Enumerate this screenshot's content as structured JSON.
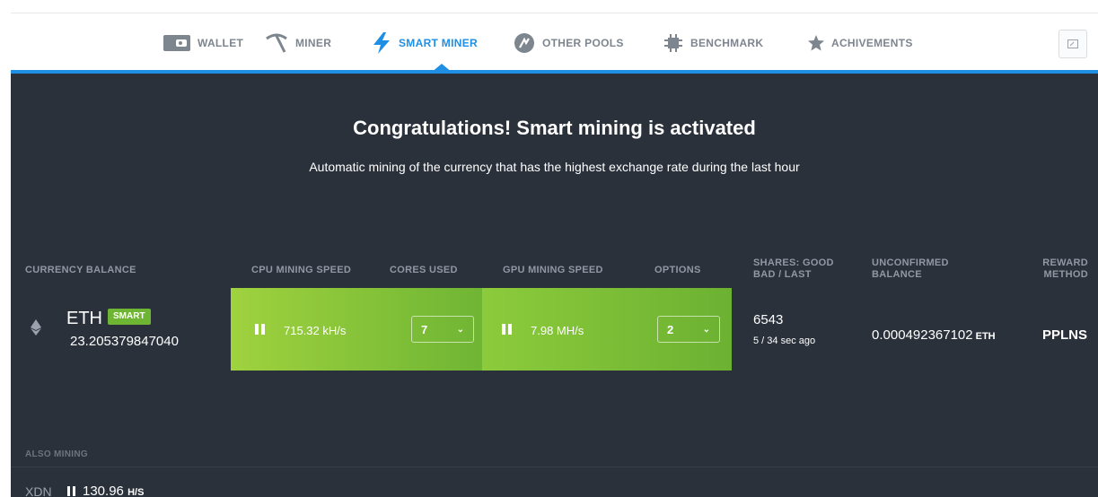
{
  "nav": {
    "tabs": [
      {
        "label": "WALLET",
        "icon": "wallet-icon"
      },
      {
        "label": "MINER",
        "icon": "pickaxe-icon"
      },
      {
        "label": "SMART MINER",
        "icon": "lightning-icon",
        "active": true
      },
      {
        "label": "OTHER POOLS",
        "icon": "pools-icon"
      },
      {
        "label": "BENCHMARK",
        "icon": "chip-icon"
      },
      {
        "label": "ACHIVEMENTS",
        "icon": "star-icon"
      }
    ],
    "corner_icon": "window-icon"
  },
  "headline": "Congratulations! Smart mining is activated",
  "subhead": "Automatic mining of the currency that has the highest exchange rate during the last hour",
  "table": {
    "headers": {
      "currency_balance": "CURRENCY BALANCE",
      "cpu_speed": "CPU MINING SPEED",
      "cores_used": "CORES USED",
      "gpu_speed": "GPU MINING SPEED",
      "options": "OPTIONS",
      "shares_line1": "SHARES: GOOD",
      "shares_line2": "BAD / LAST",
      "unconf_line1": "UNCONFIRMED",
      "unconf_line2": "BALANCE",
      "reward_line1": "REWARD",
      "reward_line2": "METHOD"
    },
    "row": {
      "currency": "ETH",
      "badge": "SMART",
      "balance": "23.205379847040",
      "cpu_speed": "715.32 kH/s",
      "cores": "7",
      "gpu_speed": "7.98 MH/s",
      "options": "2",
      "shares_good": "6543",
      "shares_bad_last": "5  / 34 sec ago",
      "unconfirmed": "0.000492367102",
      "unconfirmed_unit": "ETH",
      "reward_method": "PPLNS"
    }
  },
  "also_mining": {
    "label": "ALSO MINING",
    "currency": "XDN",
    "speed": "130.96",
    "unit": "H/S"
  },
  "colors": {
    "accent_blue": "#1f8fe4",
    "background": "#2a313b",
    "green": "#8cc63f"
  }
}
